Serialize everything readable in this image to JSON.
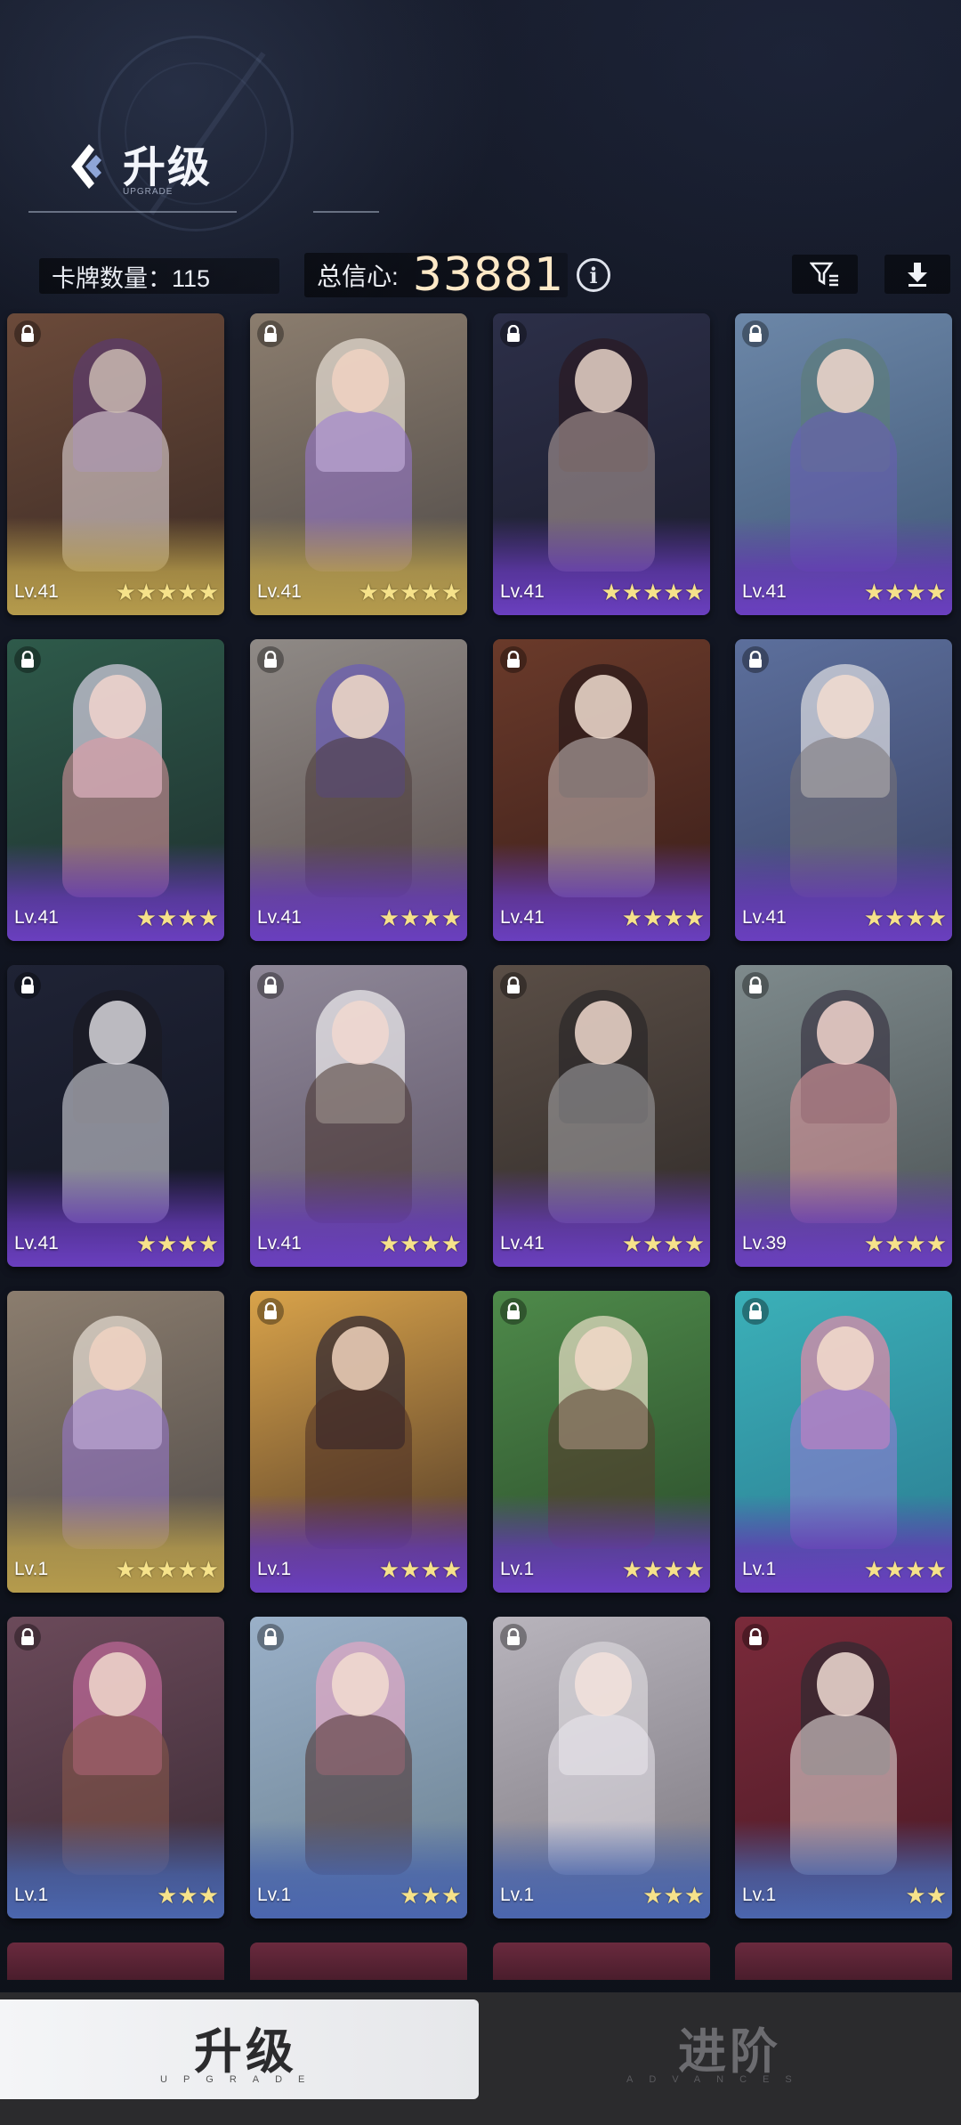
{
  "header": {
    "title": "升级",
    "subtitle": "UPGRADE",
    "card_count_label": "卡牌数量：115",
    "confidence_label": "总信心:",
    "confidence_value": "33881",
    "info_icon": "info-icon",
    "filter_icon": "filter-icon",
    "download_icon": "download-icon"
  },
  "cards": [
    {
      "level": "Lv.41",
      "stars": 5,
      "frame": "gold",
      "locked": true
    },
    {
      "level": "Lv.41",
      "stars": 5,
      "frame": "gold",
      "locked": true
    },
    {
      "level": "Lv.41",
      "stars": 5,
      "frame": "purple",
      "locked": true
    },
    {
      "level": "Lv.41",
      "stars": 4,
      "frame": "purple",
      "locked": true
    },
    {
      "level": "Lv.41",
      "stars": 4,
      "frame": "purple",
      "locked": true
    },
    {
      "level": "Lv.41",
      "stars": 4,
      "frame": "purple",
      "locked": true
    },
    {
      "level": "Lv.41",
      "stars": 4,
      "frame": "purple",
      "locked": true
    },
    {
      "level": "Lv.41",
      "stars": 4,
      "frame": "purple",
      "locked": true
    },
    {
      "level": "Lv.41",
      "stars": 4,
      "frame": "purple",
      "locked": true
    },
    {
      "level": "Lv.41",
      "stars": 4,
      "frame": "purple",
      "locked": true
    },
    {
      "level": "Lv.41",
      "stars": 4,
      "frame": "purple",
      "locked": true
    },
    {
      "level": "Lv.39",
      "stars": 4,
      "frame": "purple",
      "locked": true
    },
    {
      "level": "Lv.1",
      "stars": 5,
      "frame": "gold",
      "locked": false
    },
    {
      "level": "Lv.1",
      "stars": 4,
      "frame": "purple",
      "locked": true
    },
    {
      "level": "Lv.1",
      "stars": 4,
      "frame": "purple",
      "locked": true
    },
    {
      "level": "Lv.1",
      "stars": 4,
      "frame": "purple",
      "locked": true
    },
    {
      "level": "Lv.1",
      "stars": 3,
      "frame": "blue",
      "locked": true
    },
    {
      "level": "Lv.1",
      "stars": 3,
      "frame": "blue",
      "locked": true
    },
    {
      "level": "Lv.1",
      "stars": 3,
      "frame": "blue",
      "locked": true
    },
    {
      "level": "Lv.1",
      "stars": 2,
      "frame": "blue",
      "locked": true
    }
  ],
  "tabs": [
    {
      "label": "升级",
      "sub": "UPGRADE",
      "active": true
    },
    {
      "label": "进阶",
      "sub": "ADVANCES",
      "active": false
    }
  ],
  "colors": {
    "background": "#10141f",
    "confidence_value": "#ffe9c7",
    "star": "#f6e28a",
    "frame_gold": "#b59b4c",
    "frame_purple": "#6a3fbf",
    "frame_blue": "#4b66ae"
  }
}
